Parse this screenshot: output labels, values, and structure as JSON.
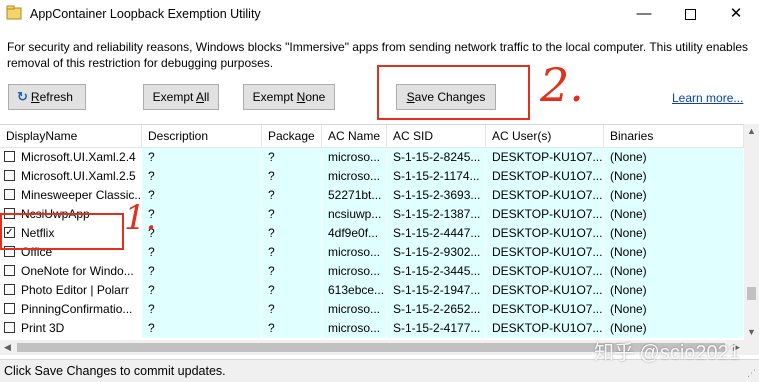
{
  "window": {
    "title": "AppContainer Loopback Exemption Utility",
    "minimize_glyph": "—",
    "close_glyph": "✕"
  },
  "info_text": "For security and reliability reasons, Windows blocks \"Immersive\" apps from sending network traffic to the local computer. This utility enables removal of this restriction for debugging purposes.",
  "toolbar": {
    "refresh": {
      "icon": "refresh-icon",
      "accel": "R",
      "rest": "efresh"
    },
    "exempt_all": {
      "pre": "Exempt ",
      "accel": "A",
      "rest": "ll"
    },
    "exempt_none": {
      "pre": "Exempt ",
      "accel": "N",
      "rest": "one"
    },
    "save": {
      "accel": "S",
      "rest": "ave Changes"
    },
    "learn_more": "Learn more..."
  },
  "annotations": {
    "two": "2.",
    "one": "1.",
    "color": "#e0301e"
  },
  "columns": [
    "DisplayName",
    "Description",
    "Package",
    "AC Name",
    "AC SID",
    "AC User(s)",
    "Binaries"
  ],
  "rows": [
    {
      "checked": false,
      "check_glyph": "",
      "name": "Microsoft.UI.Xaml.2.4",
      "desc": "?",
      "pkg": "?",
      "acname": "microso...",
      "sid": "S-1-15-2-8245...",
      "user": "DESKTOP-KU1O7...",
      "bin": "(None)"
    },
    {
      "checked": false,
      "check_glyph": "",
      "name": "Microsoft.UI.Xaml.2.5",
      "desc": "?",
      "pkg": "?",
      "acname": "microso...",
      "sid": "S-1-15-2-1174...",
      "user": "DESKTOP-KU1O7...",
      "bin": "(None)"
    },
    {
      "checked": false,
      "check_glyph": "",
      "name": "Minesweeper Classic...",
      "desc": "?",
      "pkg": "?",
      "acname": "52271bt...",
      "sid": "S-1-15-2-3693...",
      "user": "DESKTOP-KU1O7...",
      "bin": "(None)"
    },
    {
      "checked": false,
      "check_glyph": "",
      "name": "NcsiUwpApp",
      "desc": "?",
      "pkg": "?",
      "acname": "ncsiuwp...",
      "sid": "S-1-15-2-1387...",
      "user": "DESKTOP-KU1O7...",
      "bin": "(None)"
    },
    {
      "checked": true,
      "check_glyph": "✓",
      "name": "Netflix",
      "desc": "?",
      "pkg": "?",
      "acname": "4df9e0f...",
      "sid": "S-1-15-2-4447...",
      "user": "DESKTOP-KU1O7...",
      "bin": "(None)"
    },
    {
      "checked": false,
      "check_glyph": "",
      "name": "Office",
      "desc": "?",
      "pkg": "?",
      "acname": "microso...",
      "sid": "S-1-15-2-9302...",
      "user": "DESKTOP-KU1O7...",
      "bin": "(None)"
    },
    {
      "checked": false,
      "check_glyph": "",
      "name": "OneNote for Windo...",
      "desc": "?",
      "pkg": "?",
      "acname": "microso...",
      "sid": "S-1-15-2-3445...",
      "user": "DESKTOP-KU1O7...",
      "bin": "(None)"
    },
    {
      "checked": false,
      "check_glyph": "",
      "name": "Photo Editor | Polarr",
      "desc": "?",
      "pkg": "?",
      "acname": "613ebce...",
      "sid": "S-1-15-2-1947...",
      "user": "DESKTOP-KU1O7...",
      "bin": "(None)"
    },
    {
      "checked": false,
      "check_glyph": "",
      "name": "PinningConfirmatio...",
      "desc": "?",
      "pkg": "?",
      "acname": "microso...",
      "sid": "S-1-15-2-2652...",
      "user": "DESKTOP-KU1O7...",
      "bin": "(None)"
    },
    {
      "checked": false,
      "check_glyph": "",
      "name": "Print 3D",
      "desc": "?",
      "pkg": "?",
      "acname": "microso...",
      "sid": "S-1-15-2-4177...",
      "user": "DESKTOP-KU1O7...",
      "bin": "(None)"
    }
  ],
  "status_text": "Click Save Changes to commit updates.",
  "watermark": "知乎 @scio2021"
}
